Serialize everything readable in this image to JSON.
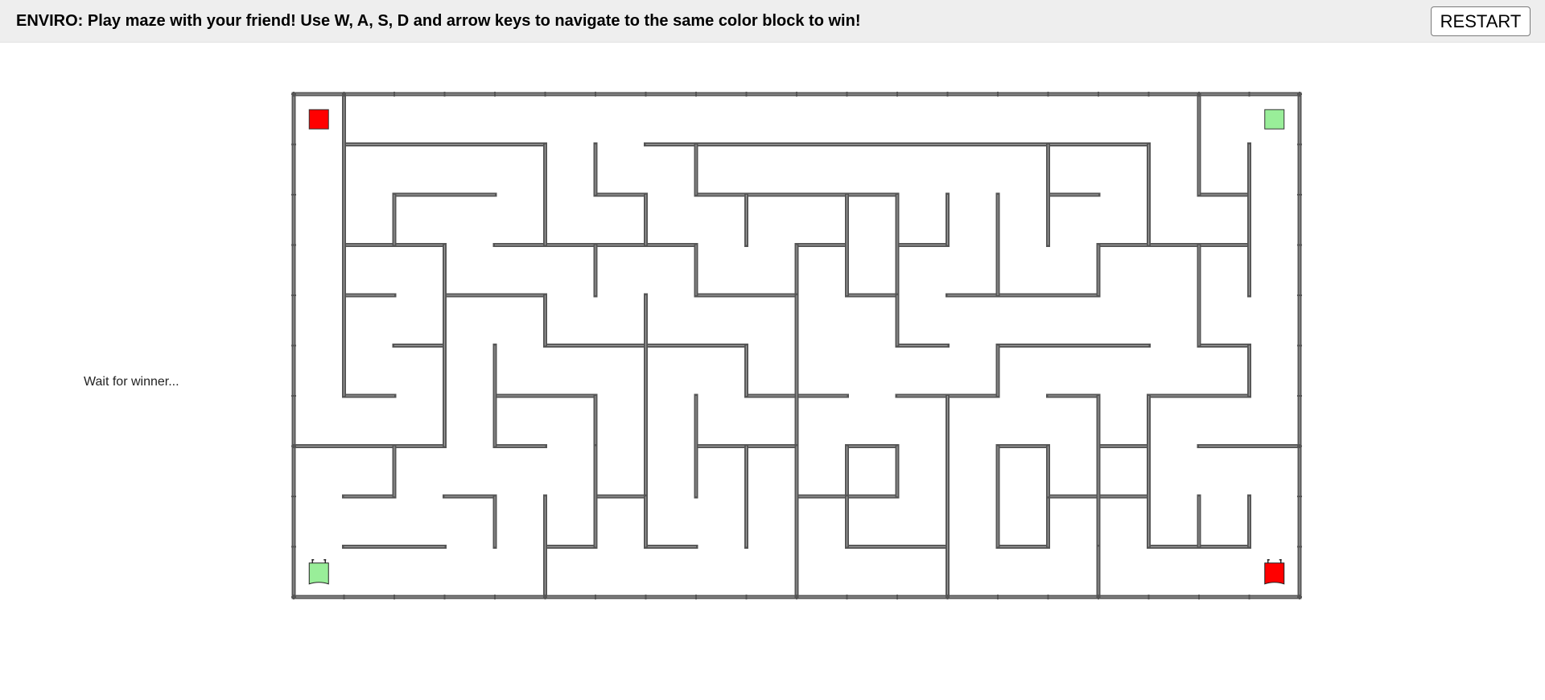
{
  "header": {
    "instructions": "ENVIRO: Play maze with your friend! Use W, A, S, D and arrow keys to navigate to the same color block to win!",
    "restart_label": "RESTART"
  },
  "status": {
    "message": "Wait for winner..."
  },
  "maze": {
    "cols": 20,
    "rows": 10,
    "wall_color": "#555555",
    "wall_highlight": "#9a9a9a",
    "horizontal_walls": [
      [
        0,
        1
      ],
      [
        2,
        9
      ],
      [
        11,
        23
      ],
      [
        12,
        13
      ],
      [
        13,
        0
      ],
      [
        13,
        5
      ],
      [
        13,
        9
      ],
      [
        14,
        2
      ],
      [
        14,
        6
      ],
      [
        14,
        10
      ],
      [
        14,
        14
      ],
      [
        14,
        15
      ],
      [
        16,
        7
      ],
      [
        16,
        9
      ],
      [
        17,
        12
      ],
      [
        17,
        15
      ],
      [
        19,
        5
      ],
      [
        19,
        19
      ],
      [
        20,
        13
      ],
      [
        22,
        7
      ],
      [
        23,
        11
      ],
      [
        24,
        3
      ],
      [
        24,
        11
      ],
      [
        25,
        0
      ],
      [
        25,
        1
      ]
    ],
    "vertical_walls": [],
    "players": [
      {
        "name": "red-player",
        "color": "#ff0000",
        "col": 19,
        "row": 9
      },
      {
        "name": "green-player",
        "color": "#99ee99",
        "col": 0,
        "row": 9
      }
    ],
    "goals": [
      {
        "name": "red-goal",
        "color": "#ff0000",
        "col": 0,
        "row": 0
      },
      {
        "name": "green-goal",
        "color": "#99ee99",
        "col": 19,
        "row": 0
      }
    ]
  }
}
